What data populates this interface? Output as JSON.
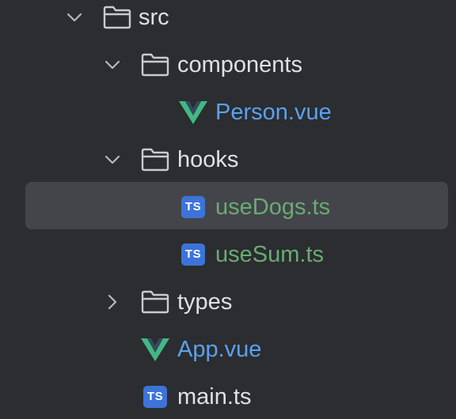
{
  "colors": {
    "background": "#2b2d30",
    "selected_row": "#43454a",
    "text": "#dfe1e5",
    "vue_file": "#5ba1ee",
    "ts_modified": "#6aab73",
    "ts_badge": "#3d73d8",
    "vue_logo_outer": "#41b883",
    "vue_logo_inner": "#35495e"
  },
  "tree": {
    "items": [
      {
        "label": "src",
        "kind": "folder",
        "expanded": true,
        "icon": "folder-icon"
      },
      {
        "label": "components",
        "kind": "folder",
        "expanded": true,
        "icon": "folder-icon"
      },
      {
        "label": "Person.vue",
        "kind": "vue",
        "icon": "vue-icon"
      },
      {
        "label": "hooks",
        "kind": "folder",
        "expanded": true,
        "icon": "folder-icon"
      },
      {
        "label": "useDogs.ts",
        "kind": "ts",
        "selected": true,
        "icon": "typescript-icon"
      },
      {
        "label": "useSum.ts",
        "kind": "ts",
        "icon": "typescript-icon"
      },
      {
        "label": "types",
        "kind": "folder",
        "expanded": false,
        "icon": "folder-icon"
      },
      {
        "label": "App.vue",
        "kind": "vue",
        "icon": "vue-icon"
      },
      {
        "label": "main.ts",
        "kind": "ts",
        "icon": "typescript-icon"
      }
    ],
    "ts_badge_text": "TS"
  }
}
